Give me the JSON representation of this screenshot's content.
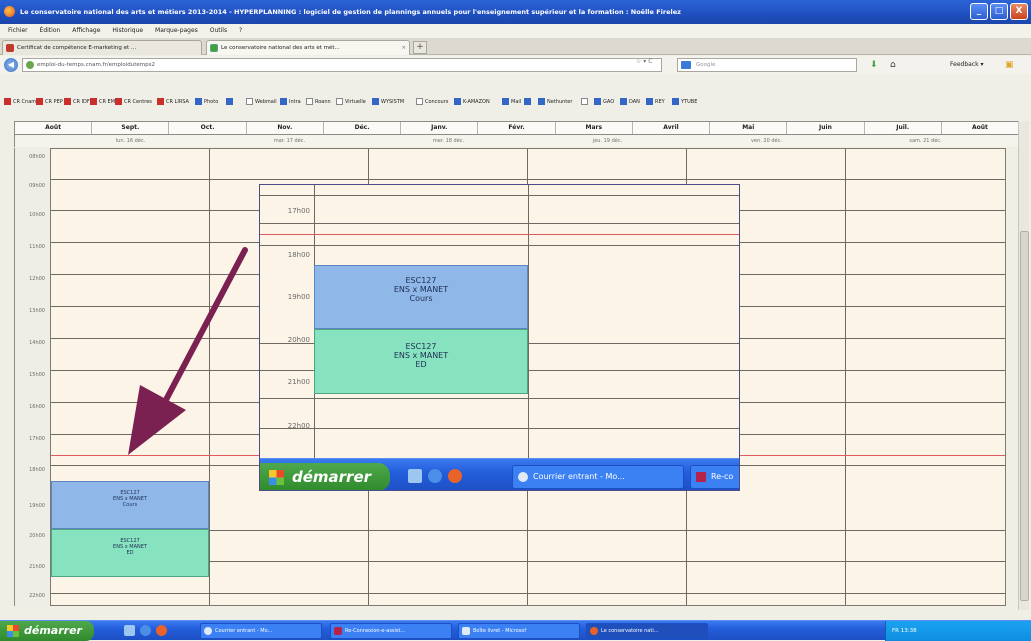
{
  "window": {
    "title": "Le conservatoire national des arts et métiers 2013-2014 - HYPERPLANNING : logiciel de gestion de plannings annuels pour l'enseignement supérieur et la formation : Noëlle Firelez",
    "minimize": "_",
    "maximize": "□",
    "close": "X"
  },
  "menu": [
    "Fichier",
    "Édition",
    "Affichage",
    "Historique",
    "Marque-pages",
    "Outils",
    "?"
  ],
  "tabs": [
    {
      "label": "Certificat de compétence E-marketing et ...",
      "active": false
    },
    {
      "label": "Le conservatoire national des arts et mét...",
      "active": true
    }
  ],
  "tab_close": "×",
  "new_tab": "+",
  "nav": {
    "url": "emploi-du-temps.cnam.fr/emploidutemps2",
    "url_controls": "☆ ▾ C",
    "search_placeholder": "Google",
    "feedback": "Feedback ▾"
  },
  "bookmarks": [
    "CR Cnam",
    "CR PEP",
    "CR IDF",
    "CR EM",
    "CR Centres",
    "CR LIRSA",
    "Photo",
    "",
    "Webmail",
    "Intra",
    "Roann",
    "Virtuelle",
    "WYSISTM",
    "Concours",
    "K-AMAZON",
    "Mail",
    "",
    "Nethunter",
    "",
    "GAO",
    "DAN",
    "REY",
    "YTUBE"
  ],
  "months": [
    "Août",
    "Sept.",
    "Oct.",
    "Nov.",
    "Déc.",
    "Janv.",
    "Févr.",
    "Mars",
    "Avril",
    "Mai",
    "Juin",
    "Juil.",
    "Août"
  ],
  "days": [
    "lun. 16 déc.",
    "mar. 17 déc.",
    "mer. 18 déc.",
    "jeu. 19 déc.",
    "ven. 20 déc.",
    "sam. 21 déc."
  ],
  "hours": [
    "08h00",
    "09h00",
    "10h00",
    "11h00",
    "12h00",
    "13h00",
    "14h00",
    "15h00",
    "16h00",
    "17h00",
    "18h00",
    "19h00",
    "20h00",
    "21h00",
    "22h00"
  ],
  "courses": [
    {
      "code": "ESC127",
      "teacher": "ENS x MANET",
      "type": "Cours",
      "color": "#8fb7e8"
    },
    {
      "code": "ESC127",
      "teacher": "ENS x MANET",
      "type": "ED",
      "color": "#86e2bf"
    }
  ],
  "inset": {
    "hours": [
      "17h00",
      "18h00",
      "19h00",
      "20h00",
      "21h00",
      "22h00"
    ],
    "start": "démarrer",
    "task1": "Courrier entrant - Mo...",
    "task2": "Re-co"
  },
  "taskbar": {
    "start": "démarrer",
    "items": [
      "Courrier entrant - Mo...",
      "Re-Connexion-e-assist...",
      "Boîte livret - Microsof",
      "Le conservatoire nati..."
    ],
    "tray_time": "FR  13:38"
  },
  "colors": {
    "arrow": "#7b2151",
    "red_line": "#e05b60",
    "grid_bg": "#fdf4e8"
  }
}
